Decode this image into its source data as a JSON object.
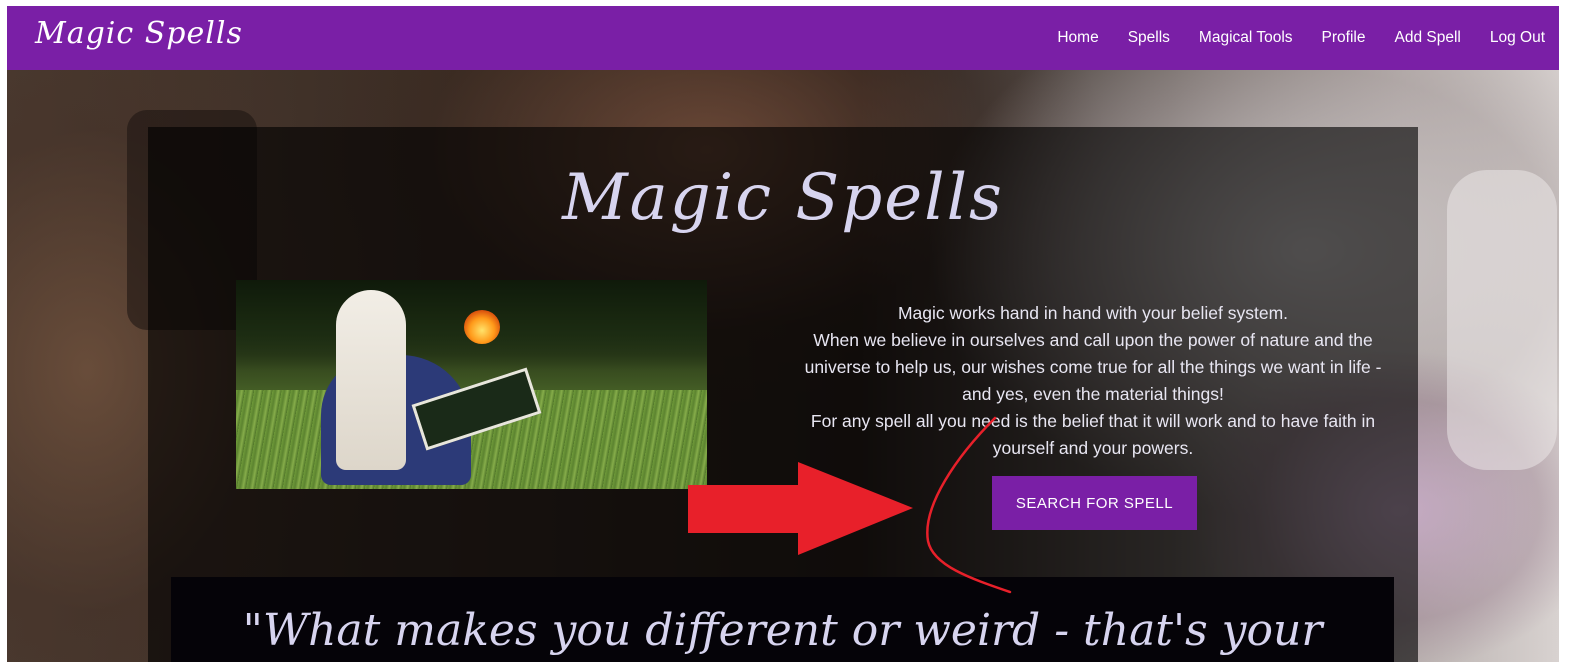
{
  "navbar": {
    "brand": "Magic Spells",
    "links": [
      "Home",
      "Spells",
      "Magical Tools",
      "Profile",
      "Add Spell",
      "Log Out"
    ],
    "background": "#7a1fa6"
  },
  "hero": {
    "title": "Magic Spells",
    "text": [
      "Magic works hand in hand with your belief system.",
      "When we believe in ourselves and call upon the power of nature and the universe to help us, our wishes come true for all the things we want in life - and yes, even the material things!",
      "For any spell all you need is the belief that it will work and to have faith in yourself and your powers."
    ],
    "button_label": "SEARCH FOR SPELL",
    "quote": "\"What makes you different or weird - that's your"
  },
  "colors": {
    "accent": "#7a1fa6",
    "title_text": "#d7d4ef",
    "annotation_red": "#e8202a"
  }
}
